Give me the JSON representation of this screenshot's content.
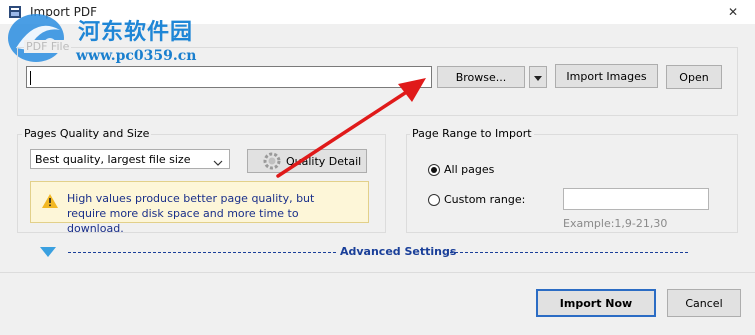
{
  "window": {
    "title": "Import PDF",
    "close_glyph": "✕"
  },
  "watermark": {
    "line1": "河东软件园",
    "line2": "www.pc0359.cn"
  },
  "pdf_file": {
    "label": "PDF File",
    "value": "",
    "browse_label": "Browse...",
    "import_images_label": "Import Images",
    "open_label": "Open"
  },
  "quality": {
    "label": "Pages Quality and Size",
    "selected": "Best quality, largest file size",
    "detail_label": "Quality Detail",
    "warning": "High values produce better page quality, but require more disk space and more time to download."
  },
  "range": {
    "label": "Page Range to Import",
    "all_label": "All pages",
    "custom_label": "Custom range:",
    "custom_value": "",
    "example": "Example:1,9-21,30",
    "selected": "all"
  },
  "advanced": {
    "label": "Advanced Settings"
  },
  "footer": {
    "import_label": "Import Now",
    "cancel_label": "Cancel"
  },
  "colors": {
    "accent": "#1a3f99",
    "arrow": "#e01a1a",
    "warning_bg": "#fdf6d8"
  },
  "icons": {
    "title": "app-icon",
    "dropdown": "chevron-down-icon",
    "quality": "gear-icon",
    "warning": "warning-icon",
    "advanced": "triangle-down-icon",
    "close": "close-icon"
  }
}
